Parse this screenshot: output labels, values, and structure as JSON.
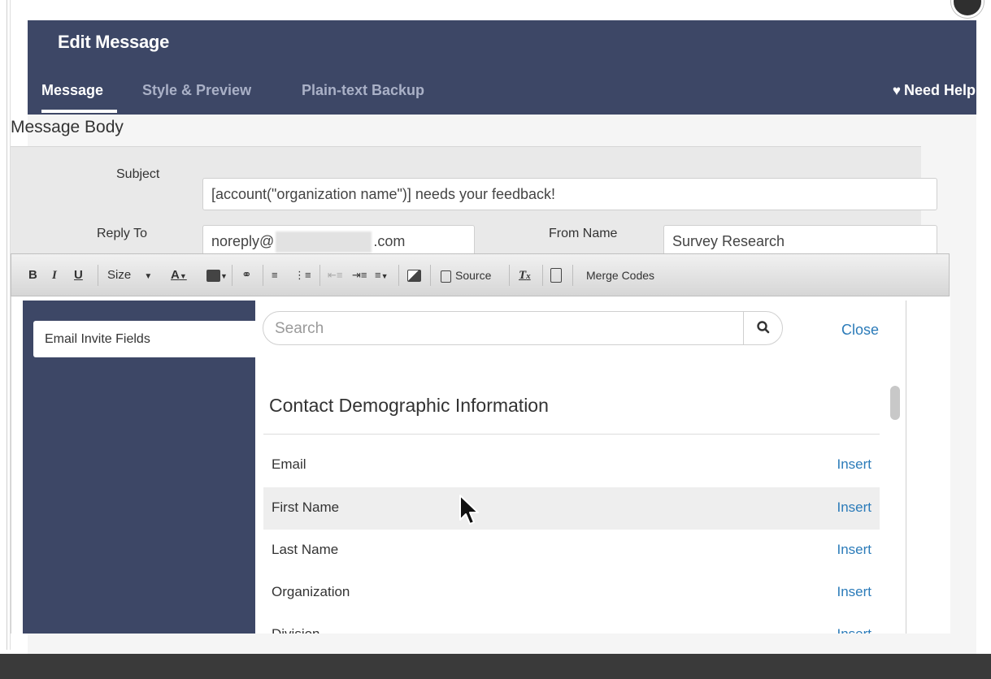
{
  "modal": {
    "title": "Edit Message",
    "tabs": [
      {
        "label": "Message",
        "active": true
      },
      {
        "label": "Style & Preview",
        "active": false
      },
      {
        "label": "Plain-text Backup",
        "active": false
      }
    ],
    "help_label": "Need Help?",
    "help_icon": "heart-icon"
  },
  "body": {
    "section_title": "Message Body",
    "subject_label": "Subject",
    "subject_value": "[account(\"organization name\")] needs your feedback!",
    "reply_to_label": "Reply To",
    "reply_to_prefix": "noreply@",
    "reply_to_suffix": ".com",
    "from_name_label": "From Name",
    "from_name_value": "Survey Research"
  },
  "toolbar": {
    "bold": "B",
    "italic": "I",
    "underline": "U",
    "size": "Size",
    "font_color": "A",
    "source": "Source",
    "clear_format": "T",
    "merge_codes": "Merge Codes"
  },
  "merge_panel": {
    "sidebar_item": "Email Invite Fields",
    "search_placeholder": "Search",
    "close_label": "Close",
    "group_title": "Contact Demographic Information",
    "insert_label": "Insert",
    "fields": [
      {
        "name": "Email"
      },
      {
        "name": "First Name"
      },
      {
        "name": "Last Name"
      },
      {
        "name": "Organization"
      },
      {
        "name": "Division"
      }
    ]
  },
  "colors": {
    "header_bg": "#3d4766",
    "link": "#2b7bb9"
  }
}
